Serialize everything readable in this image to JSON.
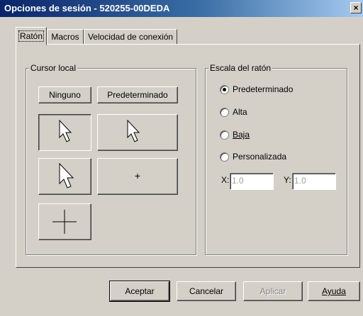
{
  "window": {
    "title": "Opciones de sesión - 520255-00DEDA",
    "close_glyph": "×"
  },
  "tabs": [
    {
      "label": "Ratón",
      "active": true
    },
    {
      "label": "Macros",
      "active": false
    },
    {
      "label": "Velocidad de conexión",
      "active": false
    }
  ],
  "cursor_group": {
    "legend": "Cursor local",
    "ninguno_label": "Ninguno",
    "predeterminado_label": "Predeterminado",
    "icons": [
      "arrow-cursor-icon",
      "arrow-cursor-icon",
      "arrow-cursor-icon",
      "small-crosshair-icon",
      "large-crosshair-icon"
    ],
    "small_cross_glyph": "+"
  },
  "scale_group": {
    "legend": "Escala del ratón",
    "options": [
      {
        "label": "Predeterminado",
        "selected": true
      },
      {
        "label": "Alta",
        "selected": false
      },
      {
        "label": "Baja",
        "selected": false
      },
      {
        "label": "Personalizada",
        "selected": false
      }
    ],
    "x_label": "X:",
    "x_value": "1.0",
    "y_label": "Y:",
    "y_value": "1.0"
  },
  "buttons": {
    "ok": "Aceptar",
    "cancel": "Cancelar",
    "apply": "Aplicar",
    "help": "Ayuda"
  }
}
